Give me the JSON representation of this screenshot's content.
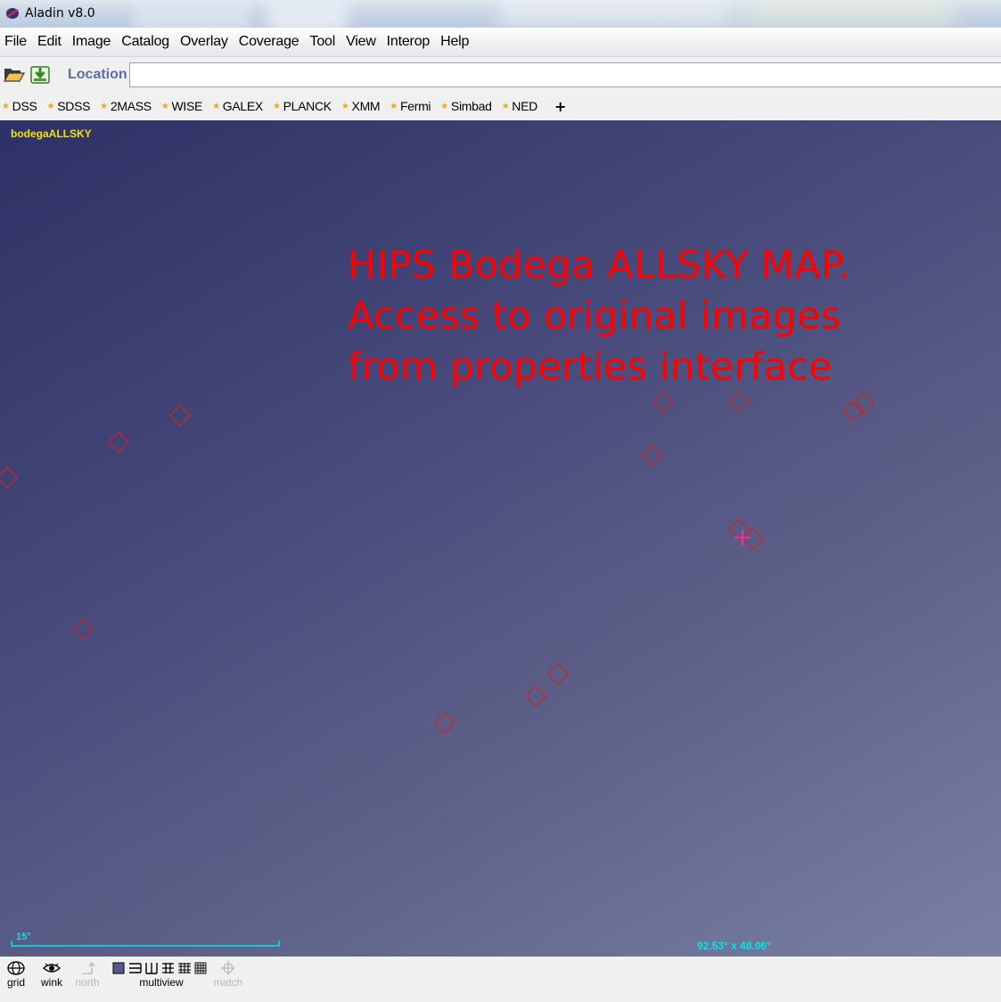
{
  "window": {
    "title": "Aladin v8.0"
  },
  "menubar": {
    "items": [
      "File",
      "Edit",
      "Image",
      "Catalog",
      "Overlay",
      "Coverage",
      "Tool",
      "View",
      "Interop",
      "Help"
    ]
  },
  "location": {
    "label": "Location",
    "value": ""
  },
  "surveys": {
    "items": [
      "DSS",
      "SDSS",
      "2MASS",
      "WISE",
      "GALEX",
      "PLANCK",
      "XMM",
      "Fermi",
      "Simbad",
      "NED"
    ],
    "add_label": "+"
  },
  "view": {
    "hips_name": "bodegaALLSKY",
    "annotation": [
      "HIPS Bodega ALLSKY MAP.",
      "Access to original images",
      "from properties interface"
    ],
    "scale": "15°",
    "fov": "92.53° x 48.06°"
  },
  "bottom_tools": {
    "grid": "grid",
    "wink": "wink",
    "north": "north",
    "multiview": "multiview",
    "match": "match"
  },
  "colors": {
    "annotation": "#ff0000",
    "hips_label": "#f4e300",
    "overlay_markers": "#c0282e",
    "scale_fov": "#00e6e6"
  }
}
